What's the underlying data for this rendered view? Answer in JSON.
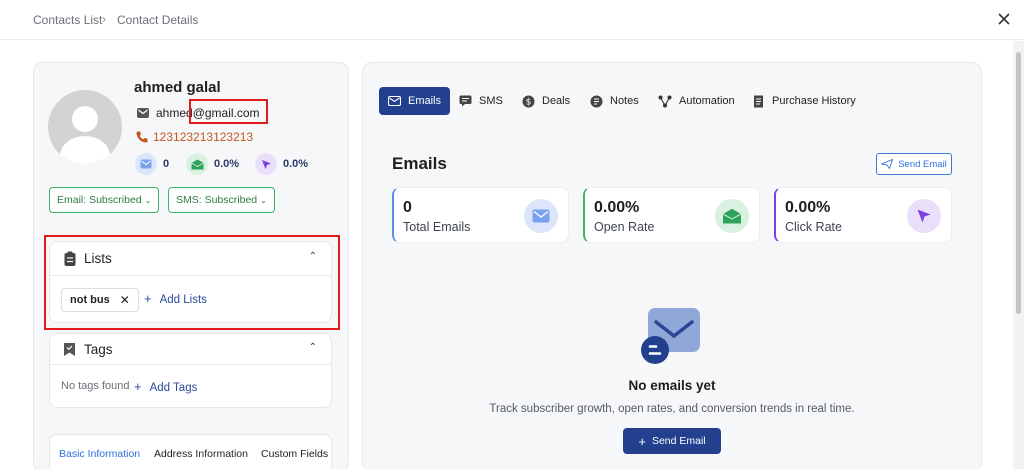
{
  "breadcrumb": {
    "parent": "Contacts List",
    "separator": "›",
    "current": "Contact Details"
  },
  "contact": {
    "name": "ahmed galal",
    "email": "ahmed@gmail.com",
    "phone": "123123213123213",
    "mini_stats": {
      "emails": "0",
      "open_rate": "0.0%",
      "click_rate": "0.0%"
    },
    "email_subscription": "Email: Subscribed",
    "sms_subscription": "SMS: Subscribed"
  },
  "lists_card": {
    "title": "Lists",
    "chips": [
      "not bus"
    ],
    "add_label": "Add Lists"
  },
  "tags_card": {
    "title": "Tags",
    "empty_text": "No tags found",
    "add_label": "Add Tags"
  },
  "info_tabs": [
    "Basic Information",
    "Address Information",
    "Custom Fields"
  ],
  "tabs": [
    "Emails",
    "SMS",
    "Deals",
    "Notes",
    "Automation",
    "Purchase History"
  ],
  "emails_section": {
    "title": "Emails",
    "send_button": "Send Email",
    "stats": [
      {
        "value": "0",
        "label": "Total Emails",
        "accent": "#5b8fe6"
      },
      {
        "value": "0.00%",
        "label": "Open Rate",
        "accent": "#3fb36a"
      },
      {
        "value": "0.00%",
        "label": "Click Rate",
        "accent": "#7b3fe0"
      }
    ],
    "empty_title": "No emails yet",
    "empty_subtitle": "Track subscriber growth, open rates, and conversion trends in real time.",
    "empty_button": "Send Email"
  },
  "colors": {
    "primary": "#23408e",
    "highlight_box": "#e01b1b",
    "subscribed_green": "#3fb36a",
    "phone_orange": "#c2561f"
  }
}
